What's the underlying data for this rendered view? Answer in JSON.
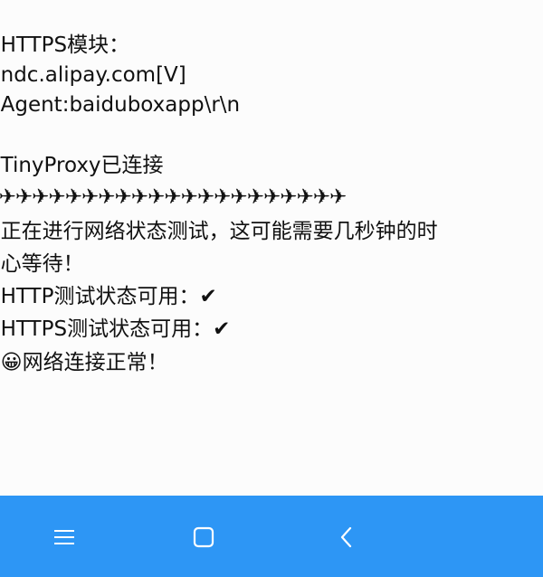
{
  "terminal": {
    "lines": [
      "  HTTPS模块：",
      "  ndc.alipay.com[V]",
      "  Agent:baiduboxapp\\r\\n",
      "",
      "  TinyProxy已连接",
      "  ✈✈✈✈✈✈✈✈✈✈✈✈✈✈✈✈✈✈✈✈✈",
      "  正在进行网络状态测试，这可能需要几秒钟的时",
      "  心等待！",
      "  HTTP测试状态可用：✔",
      "  HTTPS测试状态可用：✔",
      "  😀网络连接正常！"
    ]
  },
  "navbar": {
    "background_color": "#2d96f5",
    "icon_color": "#ffffff",
    "buttons": [
      {
        "name": "menu",
        "icon": "menu-icon"
      },
      {
        "name": "home",
        "icon": "square-home-icon"
      },
      {
        "name": "back",
        "icon": "chevron-left-icon"
      }
    ]
  }
}
